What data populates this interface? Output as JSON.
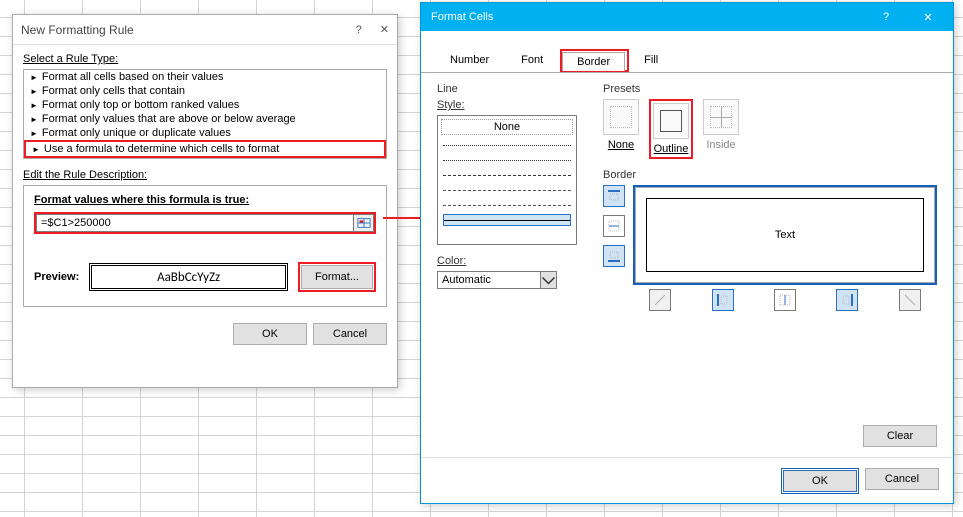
{
  "dlg1": {
    "title": "New Formatting Rule",
    "help": "?",
    "close": "✕",
    "select_label": "Select a Rule Type:",
    "rules": [
      "Format all cells based on their values",
      "Format only cells that contain",
      "Format only top or bottom ranked values",
      "Format only values that are above or below average",
      "Format only unique or duplicate values",
      "Use a formula to determine which cells to format"
    ],
    "edit_label": "Edit the Rule Description:",
    "formula_label": "Format values where this formula is true:",
    "formula_value": "=$C1>250000",
    "preview_label": "Preview:",
    "preview_text": "AaBbCcYyZz",
    "format_btn": "Format...",
    "ok": "OK",
    "cancel": "Cancel"
  },
  "dlg2": {
    "title": "Format Cells",
    "help": "?",
    "close": "✕",
    "tabs": {
      "number": "Number",
      "font": "Font",
      "border": "Border",
      "fill": "Fill"
    },
    "line_label": "Line",
    "style_label": "Style:",
    "style_none": "None",
    "color_label": "Color:",
    "color_value": "Automatic",
    "presets_label": "Presets",
    "presets": {
      "none": "None",
      "outline": "Outline",
      "inside": "Inside"
    },
    "border_label": "Border",
    "preview_text": "Text",
    "clear": "Clear",
    "ok": "OK",
    "cancel": "Cancel"
  }
}
